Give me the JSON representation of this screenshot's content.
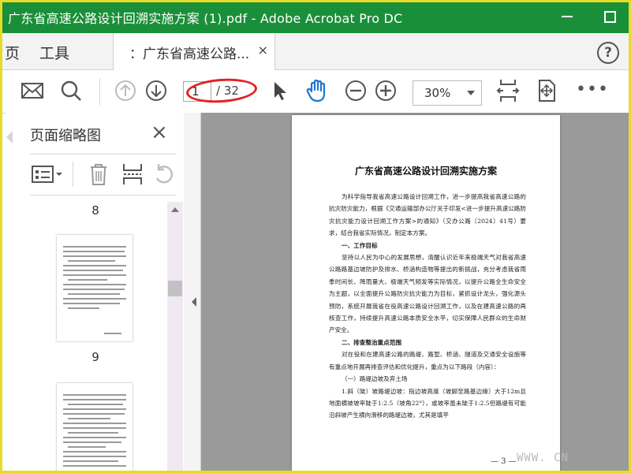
{
  "window": {
    "title": "广东省高速公路设计回溯实施方案 (1).pdf - Adobe Acrobat Pro DC"
  },
  "menu": {
    "home_partial": "页",
    "tools": "工具",
    "tab_label": "：广东省高速公路...",
    "tab_close": "×",
    "help": "?"
  },
  "toolbar": {
    "current_page": "1",
    "total_pages": "/ 32",
    "zoom": "30%",
    "more": "•••"
  },
  "sidebar": {
    "title": "页面缩略图",
    "close": "×",
    "thumbnails": [
      {
        "page_number": "8"
      },
      {
        "page_number": "9"
      }
    ]
  },
  "document": {
    "title": "广东省高速公路设计回溯实施方案",
    "paragraphs": [
      {
        "style": "p",
        "text": "为科学指导我省高速公路设计回溯工作，进一步提高我省高速公路的抗灾防灾能力，根据《交通运输部办公厅关于印发<进一步提升高速公路防灾抗灾能力设计回溯工作方案>的通知》（交办公路〔2024〕41号）要求，结合我省实际情况，制定本方案。"
      },
      {
        "style": "h",
        "text": "一、工作目标"
      },
      {
        "style": "p",
        "text": "坚持以人民为中心的发展思想，清醒认识近年来极端天气对我省高速公路路基边坡防护及排水、桥涵构造物等提出的新挑战，充分考虑我省雨季时间长、降雨量大、极端天气频发等实际情况，以提升公路全生命安全为主题，以全面提升公路防灾抗灾能力为目标，紧抓设计龙头，强化源头预防，系统开展我省在役高速公路设计回溯工作，以及在建高速公路的再核查工作，持续提升高速公路本质安全水平，切实保障人民群众的生命财产安全。"
      },
      {
        "style": "h",
        "text": "二、排查整治重点范围"
      },
      {
        "style": "p",
        "text": "对在役和在建高速公路的路堤、路堑、桥涵、隧道及交通安全设施等有重点地开展再排查评估和优化提升，重点为以下路段（内容）："
      },
      {
        "style": "p",
        "text": "（一）路堤边坡及弃土场"
      },
      {
        "style": "p",
        "text": "1.斜（陡）坡路堤边坡：指边坡高度（坡脚至路基边缘）大于12m且地面横坡坡率陡于1:2.5（坡角22°），或坡率虽未陡于1:2.5但路堤有可能沿斜坡产生横向滑移的路堤边坡，尤其是填平"
      }
    ],
    "page_number": "— 3 —"
  },
  "overlay": {
    "watermark": "WWW. CN"
  },
  "colors": {
    "titlebar": "#1a8f3a",
    "frame": "#e5dc2a",
    "annotation": "#e02323",
    "hand_tool": "#1f77d0"
  }
}
